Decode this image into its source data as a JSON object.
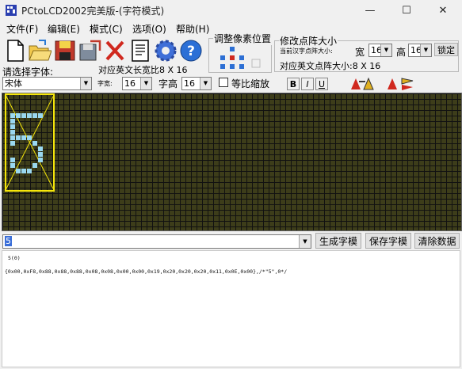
{
  "window": {
    "title": "PCtoLCD2002完美版-(字符模式)",
    "minimize_glyph": "—",
    "maximize_glyph": "☐",
    "close_glyph": "✕"
  },
  "menu": [
    "文件(F)",
    "编辑(E)",
    "模式(C)",
    "选项(O)",
    "帮助(H)"
  ],
  "toolbar": {
    "icons": [
      "new-file-icon",
      "open-folder-icon",
      "save-disk-icon",
      "save-as-icon",
      "delete-icon",
      "notes-icon",
      "gear-icon",
      "help-icon"
    ]
  },
  "font_panel": {
    "label": "请选择字体:",
    "font": "宋体",
    "char_width_label": "字宽:",
    "char_width": "16",
    "char_height_label": "字高",
    "char_height": "16",
    "scale_label": "等比缩放",
    "eng_ratio_label": "对应英文长宽比8 X 16",
    "format_buttons": [
      "B",
      "I",
      "U"
    ]
  },
  "pixel_panel": {
    "title": "调整像素位置"
  },
  "matrix_panel": {
    "title": "修改点阵大小",
    "current_label": "当前汉字点阵大小:",
    "width_label": "宽",
    "width": "16",
    "height_label": "高",
    "height": "16",
    "lock_label": "锁定",
    "eng_size_label": "对应英文点阵大小:8 X 16"
  },
  "input": {
    "value": "5"
  },
  "buttons": {
    "generate": "生成字模",
    "save": "保存字模",
    "clear": "清除数据"
  },
  "output": {
    "line1": "5(0)",
    "line2": "{0x00,0xF8,0x88,0x88,0x88,0x08,0x08,0x00,0x00,0x19,0x20,0x20,0x20,0x11,0x0E,0x00},/*\"5\",0*/"
  },
  "colors": {
    "grid_background": "#3d3d1a",
    "pixel_on": "#9ad8f0",
    "selection_border": "#f5e60a"
  }
}
